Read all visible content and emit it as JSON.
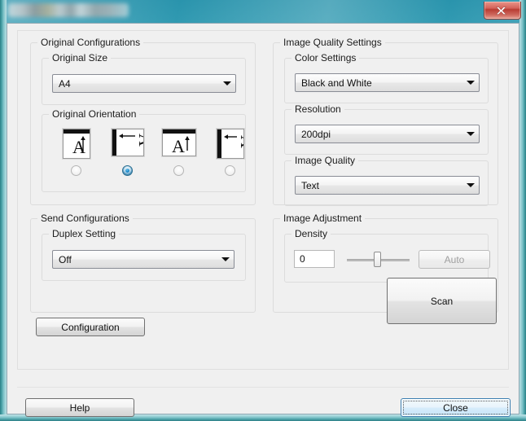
{
  "window": {
    "title": "",
    "title_redacted": true,
    "close_button_label": "X",
    "close_icon": "window-close-x-icon"
  },
  "left_panel": {
    "original_configurations": {
      "legend": "Original Configurations",
      "original_size": {
        "legend": "Original Size",
        "value": "A4",
        "arrow_icon": "chevron-down-icon"
      },
      "original_orientation": {
        "legend": "Original Orientation",
        "options": [
          {
            "icon": "orientation-portrait-top-icon",
            "selected": false
          },
          {
            "icon": "orientation-landscape-left-icon",
            "selected": true
          },
          {
            "icon": "orientation-landscape-top-icon",
            "selected": false
          },
          {
            "icon": "orientation-portrait-left-icon",
            "selected": false
          }
        ]
      }
    },
    "send_configurations": {
      "legend": "Send Configurations",
      "duplex_setting": {
        "legend": "Duplex Setting",
        "value": "Off",
        "arrow_icon": "chevron-down-icon"
      }
    }
  },
  "right_panel": {
    "image_quality_settings": {
      "legend": "Image Quality Settings",
      "color_settings": {
        "legend": "Color Settings",
        "value": "Black and White",
        "arrow_icon": "chevron-down-icon"
      },
      "resolution": {
        "legend": "Resolution",
        "value": "200dpi",
        "arrow_icon": "chevron-down-icon"
      },
      "image_quality": {
        "legend": "Image Quality",
        "value": "Text",
        "arrow_icon": "chevron-down-icon"
      }
    },
    "image_adjustment": {
      "legend": "Image Adjustment",
      "density": {
        "legend": "Density",
        "value": "0",
        "slider_position_percent": 50,
        "auto_button_label": "Auto",
        "auto_button_enabled": false
      }
    }
  },
  "actions": {
    "configuration_label": "Configuration",
    "scan_label": "Scan",
    "help_label": "Help",
    "close_label": "Close"
  },
  "colors": {
    "frame_accent": "#3badc4",
    "dialog_background": "#f0f0f0",
    "close_button_red": "#b83d33",
    "focus_blue": "#3c7fb1",
    "radio_selected_blue": "#1786c8"
  }
}
